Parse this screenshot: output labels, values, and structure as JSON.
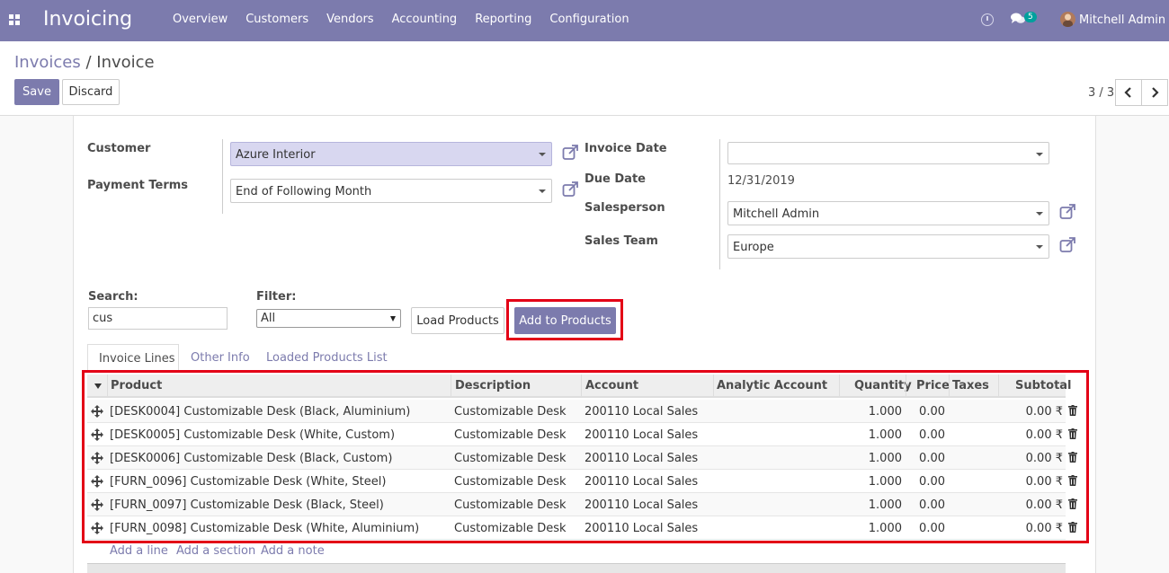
{
  "navbar": {
    "app_title": "Invoicing",
    "menu": [
      "Overview",
      "Customers",
      "Vendors",
      "Accounting",
      "Reporting",
      "Configuration"
    ],
    "chat_count": "5",
    "user": "Mitchell Admin",
    "icons": {
      "apps": "apps-grid-icon",
      "clock": "clock-icon",
      "chat": "chat-icon"
    }
  },
  "breadcrumb": {
    "parent": "Invoices",
    "separator": "/",
    "current": "Invoice"
  },
  "actions": {
    "save": "Save",
    "discard": "Discard"
  },
  "pager": {
    "value": "3 / 3"
  },
  "form": {
    "customer_label": "Customer",
    "customer_value": "Azure Interior",
    "payment_terms_label": "Payment Terms",
    "payment_terms_value": "End of Following Month",
    "invoice_date_label": "Invoice Date",
    "invoice_date_value": "",
    "due_date_label": "Due Date",
    "due_date_value": "12/31/2019",
    "salesperson_label": "Salesperson",
    "salesperson_value": "Mitchell Admin",
    "sales_team_label": "Sales Team",
    "sales_team_value": "Europe"
  },
  "search": {
    "search_label": "Search:",
    "search_value": "cus",
    "filter_label": "Filter:",
    "filter_value": "All",
    "load_button": "Load Products",
    "add_button": "Add to Products"
  },
  "tabs": [
    "Invoice Lines",
    "Other Info",
    "Loaded Products List"
  ],
  "table": {
    "headers": {
      "product": "Product",
      "description": "Description",
      "account": "Account",
      "analytic": "Analytic Account",
      "quantity": "Quantity",
      "price": "Price",
      "taxes": "Taxes",
      "subtotal": "Subtotal"
    },
    "rows": [
      {
        "product": "[DESK0004] Customizable Desk (Black, Aluminium)",
        "description": "Customizable Desk",
        "account": "200110 Local Sales",
        "quantity": "1.000",
        "price": "0.00",
        "subtotal": "0.00 ₹"
      },
      {
        "product": "[DESK0005] Customizable Desk (White, Custom)",
        "description": "Customizable Desk",
        "account": "200110 Local Sales",
        "quantity": "1.000",
        "price": "0.00",
        "subtotal": "0.00 ₹"
      },
      {
        "product": "[DESK0006] Customizable Desk (Black, Custom)",
        "description": "Customizable Desk",
        "account": "200110 Local Sales",
        "quantity": "1.000",
        "price": "0.00",
        "subtotal": "0.00 ₹"
      },
      {
        "product": "[FURN_0096] Customizable Desk (White, Steel)",
        "description": "Customizable Desk",
        "account": "200110 Local Sales",
        "quantity": "1.000",
        "price": "0.00",
        "subtotal": "0.00 ₹"
      },
      {
        "product": "[FURN_0097] Customizable Desk (Black, Steel)",
        "description": "Customizable Desk",
        "account": "200110 Local Sales",
        "quantity": "1.000",
        "price": "0.00",
        "subtotal": "0.00 ₹"
      },
      {
        "product": "[FURN_0098] Customizable Desk (White, Aluminium)",
        "description": "Customizable Desk",
        "account": "200110 Local Sales",
        "quantity": "1.000",
        "price": "0.00",
        "subtotal": "0.00 ₹"
      }
    ],
    "add_line": "Add a line",
    "add_section": "Add a section",
    "add_note": "Add a note"
  },
  "colors": {
    "brand": "#7c7bad",
    "highlight": "#e30016",
    "teal": "#00a09d"
  }
}
